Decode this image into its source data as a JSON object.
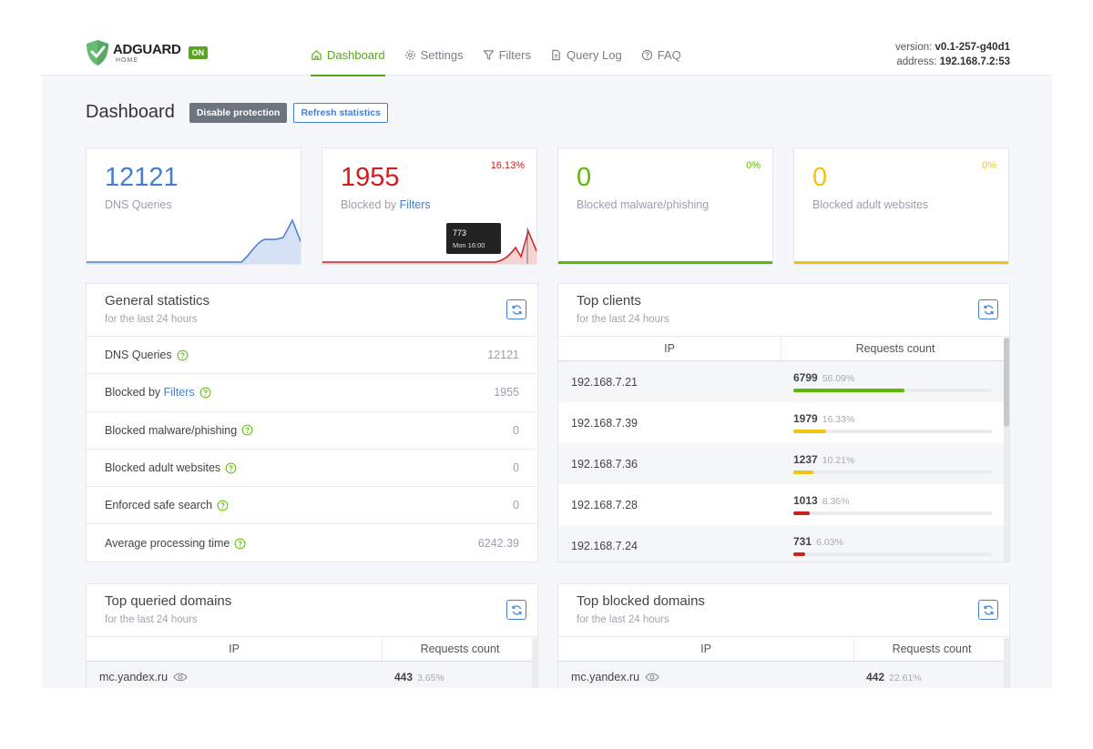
{
  "app": {
    "brand": "ADGUARD",
    "brand_sub": "HOME",
    "status_badge": "ON",
    "version_label": "version:",
    "version_value": "v0.1-257-g40d1",
    "address_label": "address:",
    "address_value": "192.168.7.2:53"
  },
  "nav": [
    {
      "label": "Dashboard",
      "icon": "home-icon",
      "active": true
    },
    {
      "label": "Settings",
      "icon": "gear-icon",
      "active": false
    },
    {
      "label": "Filters",
      "icon": "filter-icon",
      "active": false
    },
    {
      "label": "Query Log",
      "icon": "document-icon",
      "active": false
    },
    {
      "label": "FAQ",
      "icon": "help-circle-icon",
      "active": false
    }
  ],
  "page": {
    "title": "Dashboard",
    "disable_button": "Disable protection",
    "refresh_button": "Refresh statistics"
  },
  "stats": [
    {
      "value": "12121",
      "label": "DNS Queries",
      "label_link": "",
      "percent": "",
      "color": "#467fcf",
      "fill": "#d6e2f5"
    },
    {
      "value": "1955",
      "label": "Blocked by ",
      "label_link": "Filters",
      "percent": "16.13%",
      "color": "#cd201f",
      "fill": "#f6d4d3"
    },
    {
      "value": "0",
      "label": "Blocked malware/phishing",
      "label_link": "",
      "percent": "0%",
      "color": "#5eba00",
      "fill": "#e4f4d5"
    },
    {
      "value": "0",
      "label": "Blocked adult websites",
      "label_link": "",
      "percent": "0%",
      "color": "#f1c40f",
      "fill": "#fcf3cf"
    }
  ],
  "tooltip": {
    "value": "773",
    "time": "Mon 16:00"
  },
  "general": {
    "title": "General statistics",
    "subtitle": "for the last 24 hours",
    "rows": [
      {
        "name": "DNS Queries",
        "link": "",
        "value": "12121"
      },
      {
        "name": "Blocked by ",
        "link": "Filters",
        "value": "1955"
      },
      {
        "name": "Blocked malware/phishing",
        "link": "",
        "value": "0"
      },
      {
        "name": "Blocked adult websites",
        "link": "",
        "value": "0"
      },
      {
        "name": "Enforced safe search",
        "link": "",
        "value": "0"
      },
      {
        "name": "Average processing time",
        "link": "",
        "value": "6242.39"
      }
    ]
  },
  "top_clients": {
    "title": "Top clients",
    "subtitle": "for the last 24 hours",
    "col_ip": "IP",
    "col_count": "Requests count",
    "rows": [
      {
        "ip": "192.168.7.21",
        "count": "6799",
        "percent": "56.09%",
        "fraction": 0.5609,
        "color": "#5eba00"
      },
      {
        "ip": "192.168.7.39",
        "count": "1979",
        "percent": "16.33%",
        "fraction": 0.1633,
        "color": "#f1c40f"
      },
      {
        "ip": "192.168.7.36",
        "count": "1237",
        "percent": "10.21%",
        "fraction": 0.1021,
        "color": "#f1c40f"
      },
      {
        "ip": "192.168.7.28",
        "count": "1013",
        "percent": "8.36%",
        "fraction": 0.0836,
        "color": "#cd201f"
      },
      {
        "ip": "192.168.7.24",
        "count": "731",
        "percent": "6.03%",
        "fraction": 0.0603,
        "color": "#cd201f"
      }
    ]
  },
  "top_queried": {
    "title": "Top queried domains",
    "subtitle": "for the last 24 hours",
    "col_ip": "IP",
    "col_count": "Requests count",
    "rows": [
      {
        "domain": "mc.yandex.ru",
        "count": "443",
        "percent": "3.65%"
      }
    ]
  },
  "top_blocked": {
    "title": "Top blocked domains",
    "subtitle": "for the last 24 hours",
    "col_ip": "IP",
    "col_count": "Requests count",
    "rows": [
      {
        "domain": "mc.yandex.ru",
        "count": "442",
        "percent": "22.61%"
      }
    ]
  }
}
